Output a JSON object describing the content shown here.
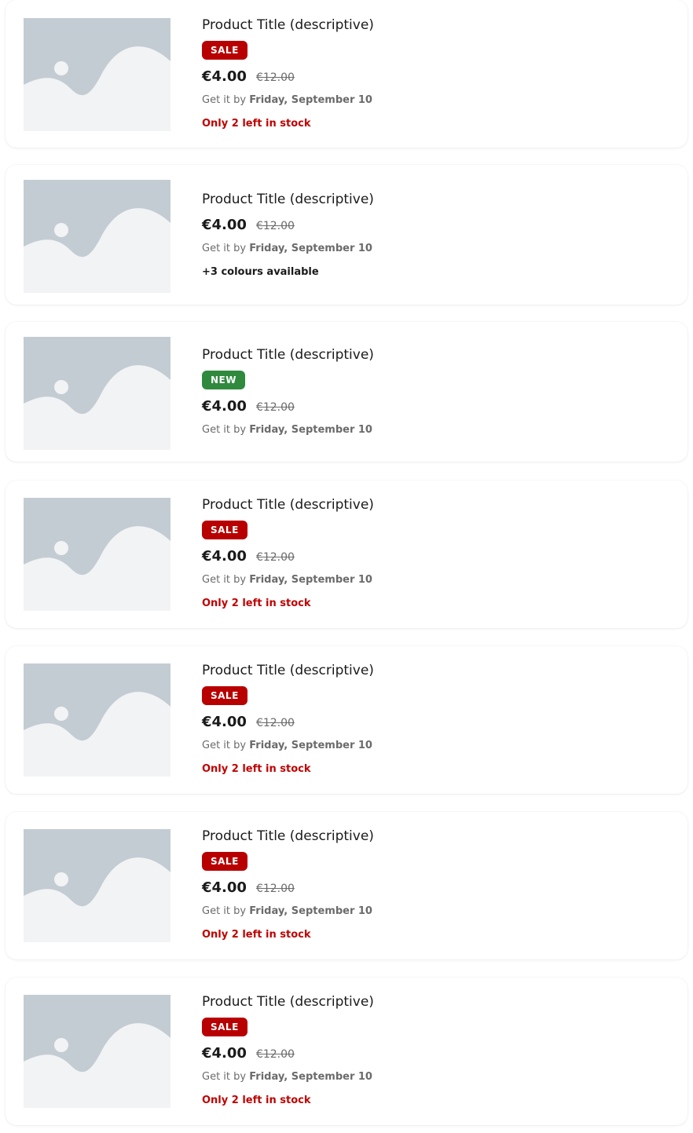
{
  "products": [
    {
      "title": "Product Title (descriptive)",
      "badge": "SALE",
      "badge_color": "#b80000",
      "price": "€4.00",
      "old_price": "€12.00",
      "delivery_prefix": "Get it by",
      "delivery_date": "Friday, September 10",
      "stock": "Only 2 left in stock",
      "stock_color": "#c00000"
    },
    {
      "title": "Product Title (descriptive)",
      "price": "€4.00",
      "old_price": "€12.00",
      "delivery_prefix": "Get it by",
      "delivery_date": "Friday, September 10",
      "colours": "+3 colours available"
    },
    {
      "title": "Product Title (descriptive)",
      "badge": "NEW",
      "badge_color": "#2f8a3e",
      "price": "€4.00",
      "old_price": "€12.00",
      "delivery_prefix": "Get it by",
      "delivery_date": "Friday, September 10"
    },
    {
      "title": "Product Title (descriptive)",
      "badge": "SALE",
      "badge_color": "#b80000",
      "price": "€4.00",
      "old_price": "€12.00",
      "delivery_prefix": "Get it by",
      "delivery_date": "Friday, September 10",
      "stock": "Only 2 left in stock",
      "stock_color": "#c00000"
    },
    {
      "title": "Product Title (descriptive)",
      "badge": "SALE",
      "badge_color": "#b80000",
      "price": "€4.00",
      "old_price": "€12.00",
      "delivery_prefix": "Get it by",
      "delivery_date": "Friday, September 10",
      "stock": "Only 2 left in stock",
      "stock_color": "#c00000"
    },
    {
      "title": "Product Title (descriptive)",
      "badge": "SALE",
      "badge_color": "#b80000",
      "price": "€4.00",
      "old_price": "€12.00",
      "delivery_prefix": "Get it by",
      "delivery_date": "Friday, September 10",
      "stock": "Only 2 left in stock",
      "stock_color": "#c00000"
    },
    {
      "title": "Product Title (descriptive)",
      "badge": "SALE",
      "badge_color": "#b80000",
      "price": "€4.00",
      "old_price": "€12.00",
      "delivery_prefix": "Get it by",
      "delivery_date": "Friday, September 10",
      "stock": "Only 2 left in stock",
      "stock_color": "#c00000"
    }
  ],
  "image_placeholder_icon": "image-placeholder-icon"
}
